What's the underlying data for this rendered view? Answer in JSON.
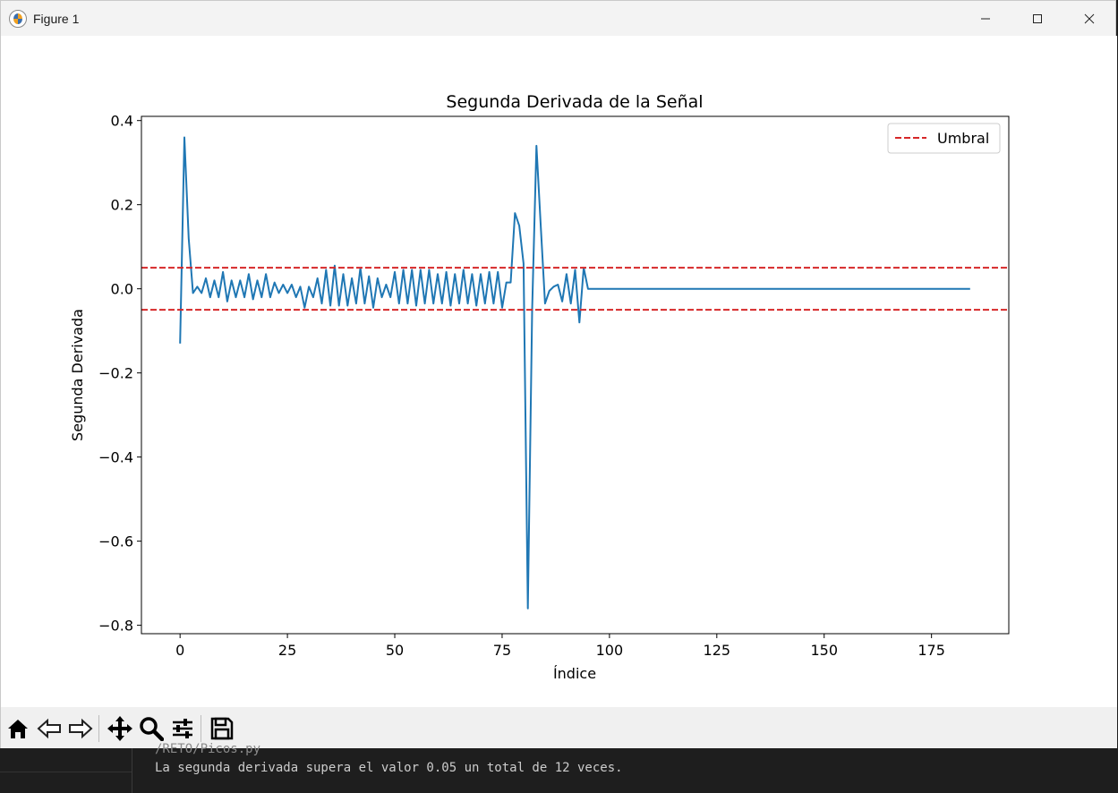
{
  "window": {
    "title": "Figure 1",
    "controls": [
      "minimize",
      "maximize",
      "close"
    ]
  },
  "toolbar": {
    "tools": [
      {
        "name": "home-icon",
        "label": "Home"
      },
      {
        "name": "back-icon",
        "label": "Back"
      },
      {
        "name": "forward-icon",
        "label": "Forward"
      },
      {
        "name": "pan-icon",
        "label": "Pan"
      },
      {
        "name": "zoom-icon",
        "label": "Zoom"
      },
      {
        "name": "configure-subplots-icon",
        "label": "Configure subplots"
      },
      {
        "name": "save-icon",
        "label": "Save"
      }
    ]
  },
  "terminal": {
    "prev_line": "/RETO/Picos.py",
    "message": "La segunda derivada supera el valor 0.05 un total de 12 veces."
  },
  "chart_data": {
    "type": "line",
    "title": "Segunda Derivada de la Señal",
    "xlabel": "Índice",
    "ylabel": "Segunda Derivada",
    "xlim": [
      -9,
      193
    ],
    "ylim": [
      -0.82,
      0.41
    ],
    "xticks": [
      0,
      25,
      50,
      75,
      100,
      125,
      150,
      175
    ],
    "yticks": [
      0.4,
      0.2,
      0.0,
      -0.2,
      -0.4,
      -0.6,
      -0.8
    ],
    "ytick_labels": [
      "0.4",
      "0.2",
      "0.0",
      "−0.2",
      "−0.4",
      "−0.6",
      "−0.8"
    ],
    "grid": false,
    "legend": {
      "position": "top-right",
      "entries": [
        "Umbral"
      ]
    },
    "series": [
      {
        "color": "#1f77b4",
        "x": [
          0,
          1,
          2,
          3,
          4,
          5,
          6,
          7,
          8,
          9,
          10,
          11,
          12,
          13,
          14,
          15,
          16,
          17,
          18,
          19,
          20,
          21,
          22,
          23,
          24,
          25,
          26,
          27,
          28,
          29,
          30,
          31,
          32,
          33,
          34,
          35,
          36,
          37,
          38,
          39,
          40,
          41,
          42,
          43,
          44,
          45,
          46,
          47,
          48,
          49,
          50,
          51,
          52,
          53,
          54,
          55,
          56,
          57,
          58,
          59,
          60,
          61,
          62,
          63,
          64,
          65,
          66,
          67,
          68,
          69,
          70,
          71,
          72,
          73,
          74,
          75,
          76,
          77,
          78,
          79,
          80,
          81,
          82,
          83,
          84,
          85,
          86,
          87,
          88,
          89,
          90,
          91,
          92,
          93,
          94,
          95,
          184
        ],
        "values": [
          -0.13,
          0.36,
          0.12,
          -0.01,
          0.005,
          -0.01,
          0.025,
          -0.02,
          0.02,
          -0.02,
          0.04,
          -0.03,
          0.02,
          -0.02,
          0.02,
          -0.02,
          0.035,
          -0.025,
          0.02,
          -0.02,
          0.035,
          -0.02,
          0.015,
          -0.01,
          0.01,
          -0.01,
          0.01,
          -0.02,
          0.005,
          -0.045,
          0.005,
          -0.02,
          0.025,
          -0.035,
          0.045,
          -0.04,
          0.055,
          -0.04,
          0.035,
          -0.04,
          0.025,
          -0.035,
          0.05,
          -0.035,
          0.03,
          -0.045,
          0.025,
          -0.02,
          0.01,
          -0.02,
          0.04,
          -0.035,
          0.045,
          -0.035,
          0.045,
          -0.04,
          0.045,
          -0.035,
          0.045,
          -0.035,
          0.035,
          -0.035,
          0.04,
          -0.04,
          0.035,
          -0.035,
          0.045,
          -0.035,
          0.035,
          -0.04,
          0.035,
          -0.035,
          0.04,
          -0.035,
          0.04,
          -0.045,
          0.015,
          0.015,
          0.18,
          0.15,
          0.06,
          -0.76,
          -0.05,
          0.34,
          0.15,
          -0.035,
          -0.005,
          0.005,
          0.01,
          -0.03,
          0.035,
          -0.035,
          0.045,
          -0.08,
          0.05,
          0.0,
          0.0
        ]
      },
      {
        "name": "Umbral",
        "color": "#d62728",
        "dashed": true,
        "y": 0.05
      },
      {
        "color": "#d62728",
        "dashed": true,
        "y": -0.05
      }
    ]
  }
}
